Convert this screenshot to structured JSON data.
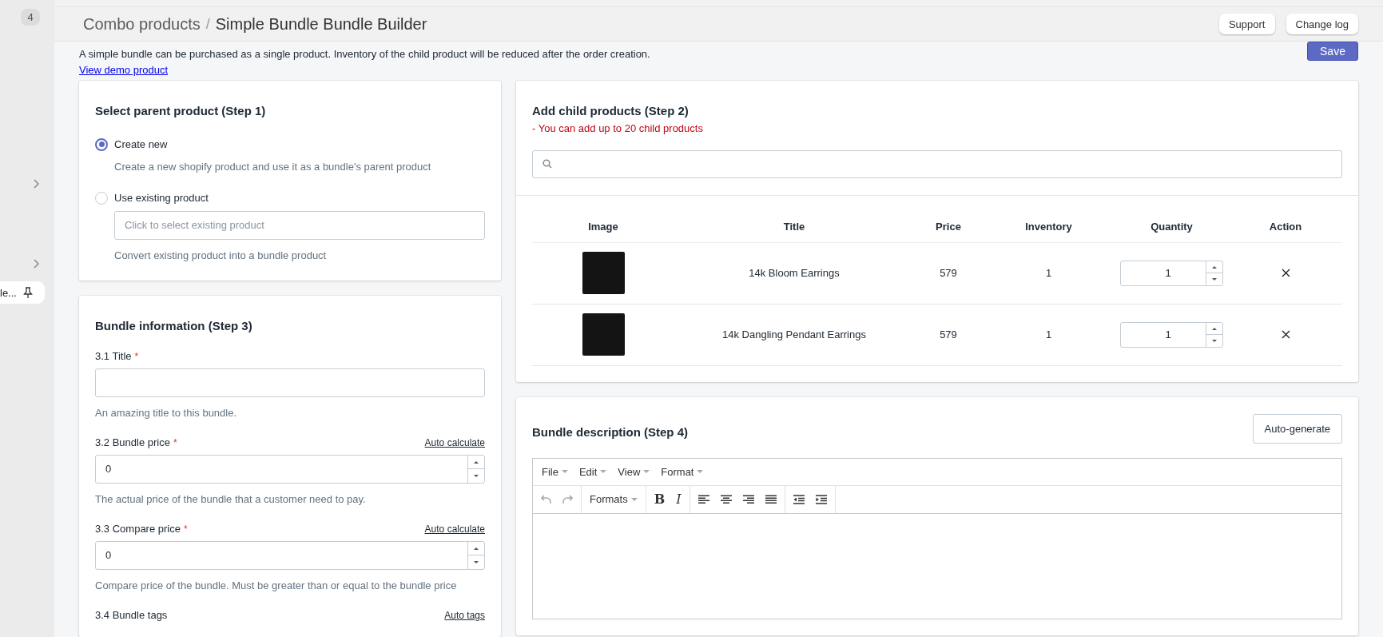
{
  "sidebar": {
    "badge": "4",
    "pinned_item": {
      "label": "le..."
    }
  },
  "header": {
    "breadcrumb": "Combo products",
    "separator": "/",
    "title": "Simple Bundle Bundle Builder",
    "buttons": [
      "Support",
      "Change log"
    ]
  },
  "intro": {
    "text": "A simple bundle can be purchased as a single product. Inventory of the child product will be reduced after the order creation.",
    "link": "View demo product"
  },
  "save_button": "Save",
  "parent_card": {
    "title": "Select parent product (Step 1)",
    "options": [
      {
        "label": "Create new",
        "selected": true,
        "help": "Create a new shopify product and use it as a bundle's parent product"
      },
      {
        "label": "Use existing product",
        "selected": false,
        "placeholder": "Click to select existing product",
        "help": "Convert existing product into a bundle product"
      }
    ]
  },
  "bundle_info": {
    "title": "Bundle information (Step 3)",
    "fields": [
      {
        "kind": "text",
        "number": "3.1",
        "label": "Title",
        "required_mark": "*",
        "help": "An amazing title to this bundle."
      },
      {
        "kind": "number",
        "number": "3.2",
        "label": "Bundle price",
        "required_mark": "*",
        "action": "Auto calculate",
        "value": "0",
        "help": "The actual price of the bundle that a customer need to pay."
      },
      {
        "kind": "number",
        "number": "3.3",
        "label": "Compare price",
        "required_mark": "*",
        "action": "Auto calculate",
        "value": "0",
        "help": "Compare price of the bundle. Must be greater than or equal to the bundle price"
      },
      {
        "kind": "heading",
        "number": "3.4",
        "label": "Bundle tags",
        "action": "Auto tags"
      }
    ]
  },
  "child_card": {
    "title": "Add child products (Step 2)",
    "note": "- You can add up to 20 child products",
    "columns": [
      "Image",
      "Title",
      "Price",
      "Inventory",
      "Quantity",
      "Action"
    ],
    "rows": [
      {
        "title": "14k Bloom Earrings",
        "price": "579",
        "inventory": "1",
        "quantity": "1"
      },
      {
        "title": "14k Dangling Pendant Earrings",
        "price": "579",
        "inventory": "1",
        "quantity": "1"
      }
    ]
  },
  "description_card": {
    "title": "Bundle description (Step 4)",
    "button": "Auto-generate",
    "editor": {
      "menus": [
        "File",
        "Edit",
        "View",
        "Format"
      ],
      "formats_label": "Formats",
      "bold_label": "B",
      "italic_label": "I"
    }
  }
}
